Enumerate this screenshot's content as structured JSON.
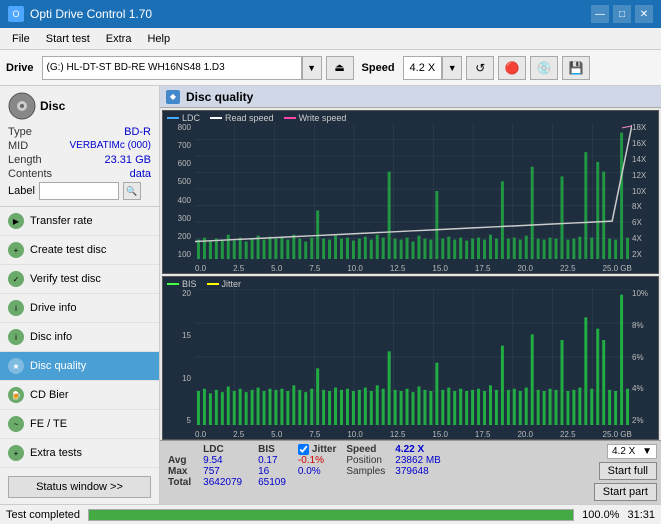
{
  "titlebar": {
    "title": "Opti Drive Control 1.70",
    "icon": "O",
    "controls": [
      "—",
      "□",
      "✕"
    ]
  },
  "menubar": {
    "items": [
      "File",
      "Start test",
      "Extra",
      "Help"
    ]
  },
  "drive_toolbar": {
    "drive_label": "Drive",
    "drive_value": "(G:)  HL-DT-ST BD-RE  WH16NS48 1.D3",
    "speed_label": "Speed",
    "speed_value": "4.2 X"
  },
  "disc_panel": {
    "title": "Disc",
    "type_label": "Type",
    "type_value": "BD-R",
    "mid_label": "MID",
    "mid_value": "VERBATIMc (000)",
    "length_label": "Length",
    "length_value": "23.31 GB",
    "contents_label": "Contents",
    "contents_value": "data",
    "label_label": "Label",
    "label_value": ""
  },
  "nav": {
    "items": [
      {
        "id": "transfer-rate",
        "label": "Transfer rate",
        "active": false
      },
      {
        "id": "create-test-disc",
        "label": "Create test disc",
        "active": false
      },
      {
        "id": "verify-test-disc",
        "label": "Verify test disc",
        "active": false
      },
      {
        "id": "drive-info",
        "label": "Drive info",
        "active": false
      },
      {
        "id": "disc-info",
        "label": "Disc info",
        "active": false
      },
      {
        "id": "disc-quality",
        "label": "Disc quality",
        "active": true
      },
      {
        "id": "cd-bier",
        "label": "CD Bier",
        "active": false
      },
      {
        "id": "fe-te",
        "label": "FE / TE",
        "active": false
      },
      {
        "id": "extra-tests",
        "label": "Extra tests",
        "active": false
      }
    ],
    "status_button": "Status window >>"
  },
  "content": {
    "title": "Disc quality",
    "upper_chart": {
      "legend": [
        {
          "label": "LDC",
          "color": "#00aaff"
        },
        {
          "label": "Read speed",
          "color": "#ffffff"
        },
        {
          "label": "Write speed",
          "color": "#ff44aa"
        }
      ],
      "y_left": [
        "800",
        "700",
        "600",
        "500",
        "400",
        "300",
        "200",
        "100"
      ],
      "y_right": [
        "18X",
        "16X",
        "14X",
        "12X",
        "10X",
        "8X",
        "6X",
        "4X",
        "2X"
      ],
      "x_labels": [
        "0.0",
        "2.5",
        "5.0",
        "7.5",
        "10.0",
        "12.5",
        "15.0",
        "17.5",
        "20.0",
        "22.5",
        "25.0 GB"
      ]
    },
    "lower_chart": {
      "legend": [
        {
          "label": "BIS",
          "color": "#00ff44"
        },
        {
          "label": "Jitter",
          "color": "#ffff00"
        }
      ],
      "y_left": [
        "20",
        "15",
        "10",
        "5"
      ],
      "y_right": [
        "10%",
        "8%",
        "6%",
        "4%",
        "2%"
      ],
      "x_labels": [
        "0.0",
        "2.5",
        "5.0",
        "7.5",
        "10.0",
        "12.5",
        "15.0",
        "17.5",
        "20.0",
        "22.5",
        "25.0 GB"
      ]
    },
    "stats": {
      "ldc_label": "LDC",
      "bis_label": "BIS",
      "jitter_label": "Jitter",
      "jitter_checked": true,
      "speed_label": "Speed",
      "speed_value": "4.22 X",
      "avg_label": "Avg",
      "avg_ldc": "9.54",
      "avg_bis": "0.17",
      "avg_jitter": "-0.1%",
      "max_label": "Max",
      "max_ldc": "757",
      "max_bis": "16",
      "max_jitter": "0.0%",
      "total_label": "Total",
      "total_ldc": "3642079",
      "total_bis": "65109",
      "position_label": "Position",
      "position_value": "23862 MB",
      "samples_label": "Samples",
      "samples_value": "379648",
      "speed_select": "4.2 X",
      "start_full_btn": "Start full",
      "start_part_btn": "Start part"
    }
  },
  "statusbar": {
    "text": "Test completed",
    "progress": 100,
    "progress_text": "100.0%",
    "time": "31:31"
  }
}
